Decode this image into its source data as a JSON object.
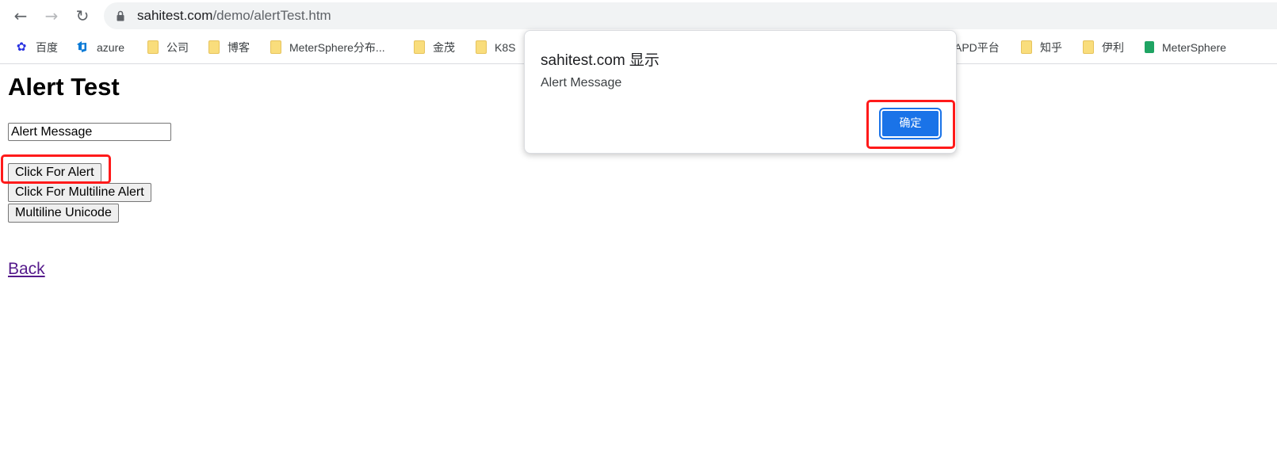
{
  "browser": {
    "back_icon": "←",
    "forward_icon": "→",
    "reload_icon": "↻",
    "url_host": "sahitest.com",
    "url_path": "/demo/alertTest.htm"
  },
  "bookmarks": [
    {
      "label": "百度",
      "icon": "baidu-icon"
    },
    {
      "label": "azure",
      "icon": "azure-icon"
    },
    {
      "label": "公司",
      "icon": "folder-icon"
    },
    {
      "label": "博客",
      "icon": "folder-icon"
    },
    {
      "label": "MeterSphere分布...",
      "icon": "folder-icon"
    },
    {
      "label": "金茂",
      "icon": "folder-icon"
    },
    {
      "label": "K8S",
      "icon": "folder-icon"
    },
    {
      "label": "APD平台",
      "icon": "folder-icon"
    },
    {
      "label": "知乎",
      "icon": "folder-icon"
    },
    {
      "label": "伊利",
      "icon": "folder-icon"
    },
    {
      "label": "MeterSphere",
      "icon": "sheets-icon"
    }
  ],
  "page": {
    "title": "Alert Test",
    "input_value": "Alert Message",
    "buttons": {
      "alert": "Click For Alert",
      "multiline": "Click For Multiline Alert",
      "unicode": "Multiline Unicode"
    },
    "back_link": "Back"
  },
  "dialog": {
    "title": "sahitest.com 显示",
    "message": "Alert Message",
    "ok_label": "确定"
  },
  "colors": {
    "accent": "#1a73e8",
    "highlight": "#ff1a1a",
    "visited_link": "#551a8b"
  }
}
